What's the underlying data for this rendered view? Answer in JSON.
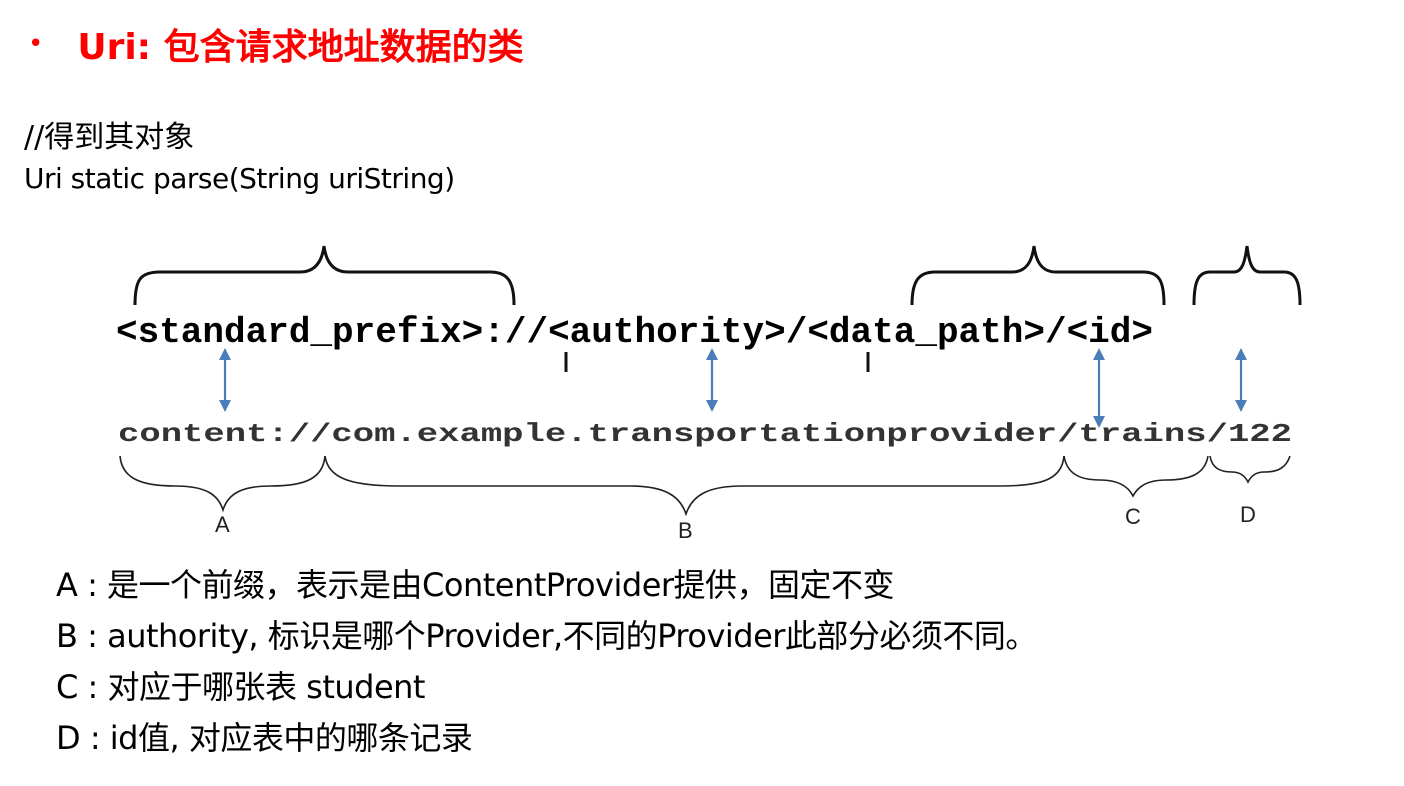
{
  "slide": {
    "bullet": "•",
    "title": "Uri: 包含请求地址数据的类",
    "comment": "//得到其对象",
    "signature": "Uri static parse(String uriString)",
    "colors": {
      "title": "#ff0000",
      "arrow": "#4a7ebb"
    }
  },
  "diagram": {
    "pattern": {
      "standard_prefix": "<standard_prefix>",
      "sep1": "://",
      "authority": "<authority>",
      "sep2": "/",
      "data_path": "<data_path>",
      "sep3": "/",
      "id": "<id>"
    },
    "example": {
      "prefix": "content://",
      "authority": "com.example.transportationprovider",
      "sep1": "/",
      "path": "trains",
      "sep2": "/",
      "id": "122"
    },
    "segments": [
      "A",
      "B",
      "C",
      "D"
    ]
  },
  "explanations": [
    "A : 是一个前缀，表示是由ContentProvider提供，固定不变",
    "B : authority, 标识是哪个Provider,不同的Provider此部分必须不同。",
    "C : 对应于哪张表 student",
    "D : id值, 对应表中的哪条记录"
  ]
}
